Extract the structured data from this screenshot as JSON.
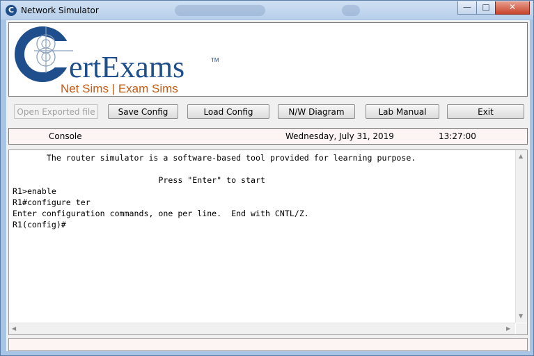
{
  "window": {
    "title": "Network Simulator",
    "icon": "certexams-c-icon",
    "buttons": {
      "minimize": "—",
      "maximize": "□",
      "close": "✕"
    }
  },
  "logo": {
    "brand": "CertExams",
    "trademark": "TM",
    "tagline": "Net Sims | Exam Sims",
    "colors": {
      "brand": "#1f4e8c",
      "tagline": "#c55a11"
    }
  },
  "toolbar": {
    "open_exported": "Open Exported file",
    "save_config": "Save Config",
    "load_config": "Load Config",
    "nw_diagram": "N/W Diagram",
    "lab_manual": "Lab Manual",
    "exit": "Exit"
  },
  "status": {
    "label": "Console",
    "date": "Wednesday, July 31, 2019",
    "time": "13:27:00"
  },
  "console": {
    "lines": [
      "       The router simulator is a software-based tool provided for learning purpose.",
      "",
      "                              Press \"Enter\" to start",
      "R1>enable",
      "R1#configure ter",
      "Enter configuration commands, one per line.  End with CNTL/Z.",
      "R1(config)#"
    ]
  },
  "scrollbars": {
    "up": "▲",
    "down": "▼",
    "left": "◀",
    "right": "▶"
  }
}
